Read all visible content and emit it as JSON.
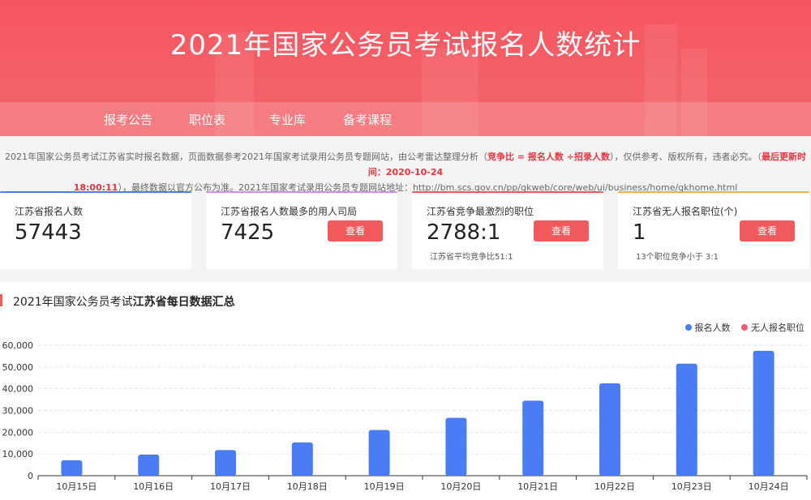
{
  "header": {
    "title": "2021年国家公务员考试报名人数统计",
    "nav": [
      "报考公告",
      "职位表",
      "专业库",
      "备考课程"
    ]
  },
  "notice": {
    "line1_a": "2021年国家公务员考试江苏省实时报名数据，页面数据参考2021年国家考试录用公务员专题网站，由公考雷达整理分析（",
    "line1_red": "竞争比 = 报名人数 ÷招录人数",
    "line1_b": "），仅供参考、版权所有，违者必究。（",
    "line1_red2": "最后更新时间：2020-10-24",
    "line2_red": "18:00:11",
    "line2_b": "），最终数据以官方公布为准。2021年国家考试录用公务员专题网站地址：http://bm.scs.gov.cn/pp/gkweb/core/web/ui/business/home/gkhome.html"
  },
  "cards": [
    {
      "label": "江苏省报名人数",
      "value": "57443",
      "button": "",
      "sub": "",
      "bar_color": "#4a7cf6"
    },
    {
      "label": "江苏省报名人数最多的用人司局",
      "value": "7425",
      "button": "查看",
      "sub": "",
      "bar_color": "#d98ce6"
    },
    {
      "label": "江苏省竞争最激烈的职位",
      "value": "2788:1",
      "button": "查看",
      "sub": "江苏省平均竞争比51:1",
      "bar_color": "#f15a5d"
    },
    {
      "label": "江苏省无人报名职位(个)",
      "value": "1",
      "button": "查看",
      "sub": "13个职位竞争小于 3:1",
      "bar_color": "#f5b042"
    }
  ],
  "chart_title": {
    "prefix": "2021年国家公务员考试",
    "bold": "江苏省每日数据汇总"
  },
  "colors": {
    "accent": "#f15a5d",
    "series1": "#4a7cf6",
    "series2": "#f15a7a"
  },
  "chart_data": {
    "type": "bar",
    "categories": [
      "10月15日",
      "10月16日",
      "10月17日",
      "10月18日",
      "10月19日",
      "10月20日",
      "10月21日",
      "10月22日",
      "10月23日",
      "10月24日"
    ],
    "series": [
      {
        "name": "报名人数",
        "values": [
          7100,
          9700,
          11800,
          15300,
          21000,
          26600,
          34500,
          42500,
          51500,
          57443
        ]
      },
      {
        "name": "无人报名职位",
        "values": [
          0,
          0,
          0,
          0,
          0,
          0,
          0,
          0,
          0,
          0
        ]
      }
    ],
    "ylim": [
      0,
      60000
    ],
    "yticks": [
      "0",
      "10,000",
      "20,000",
      "30,000",
      "40,000",
      "50,000",
      "60,000"
    ],
    "grid": true,
    "legend": "top-right"
  }
}
